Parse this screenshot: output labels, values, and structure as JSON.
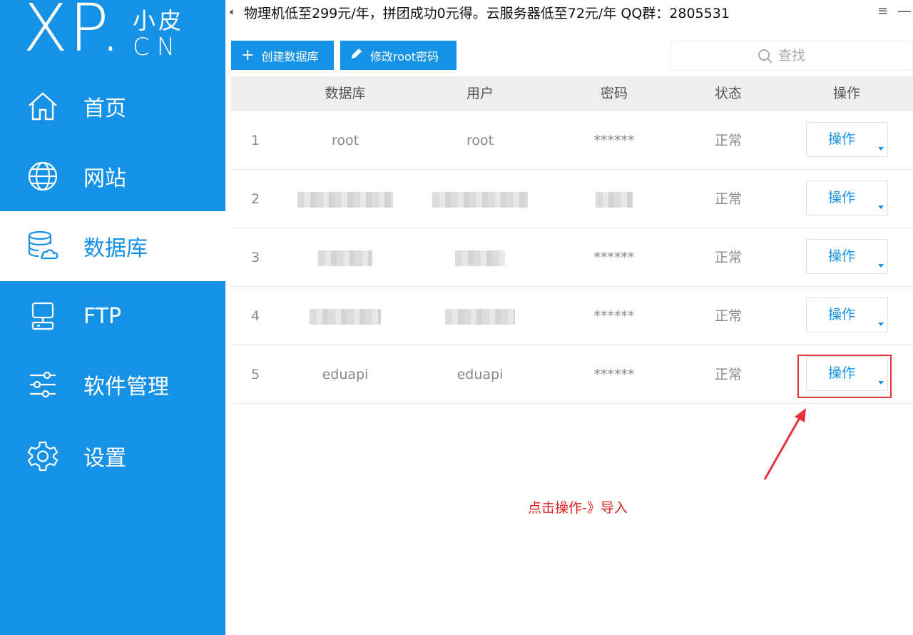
{
  "logo": {
    "main": "XP",
    "dot": ".",
    "cn_top": "小皮",
    "cn_bottom": "CN"
  },
  "sidebar": {
    "items": [
      {
        "label": "首页",
        "icon": "home-icon",
        "active": false
      },
      {
        "label": "网站",
        "icon": "globe-icon",
        "active": false
      },
      {
        "label": "数据库",
        "icon": "database-icon",
        "active": true
      },
      {
        "label": "FTP",
        "icon": "ftp-icon",
        "active": false
      },
      {
        "label": "软件管理",
        "icon": "sliders-icon",
        "active": false
      },
      {
        "label": "设置",
        "icon": "gear-icon",
        "active": false
      }
    ]
  },
  "notice": "物理机低至299元/年，拼团成功0元得。云服务器低至72元/年  QQ群：2805531",
  "toolbar": {
    "create_label": "创建数据库",
    "root_label": "修改root密码"
  },
  "search": {
    "placeholder": "查找"
  },
  "table": {
    "headers": [
      "数据库",
      "用户",
      "密码",
      "状态",
      "操作"
    ],
    "rows": [
      {
        "index": "1",
        "database": "root",
        "user": "root",
        "password": "******",
        "status": "正常",
        "action": "操作"
      },
      {
        "index": "2",
        "database": "",
        "user": "",
        "password": "",
        "status": "正常",
        "action": "操作"
      },
      {
        "index": "3",
        "database": "",
        "user": "",
        "password": "******",
        "status": "正常",
        "action": "操作"
      },
      {
        "index": "4",
        "database": "",
        "user": "",
        "password": "******",
        "status": "正常",
        "action": "操作"
      },
      {
        "index": "5",
        "database": "eduapi",
        "user": "eduapi",
        "password": "******",
        "status": "正常",
        "action": "操作"
      }
    ]
  },
  "annotation": {
    "text": "点击操作-》导入",
    "color": "#e02020"
  },
  "colors": {
    "primary": "#1592e6",
    "header_bg": "#eeeeee",
    "annotation_red": "#e8323c"
  }
}
